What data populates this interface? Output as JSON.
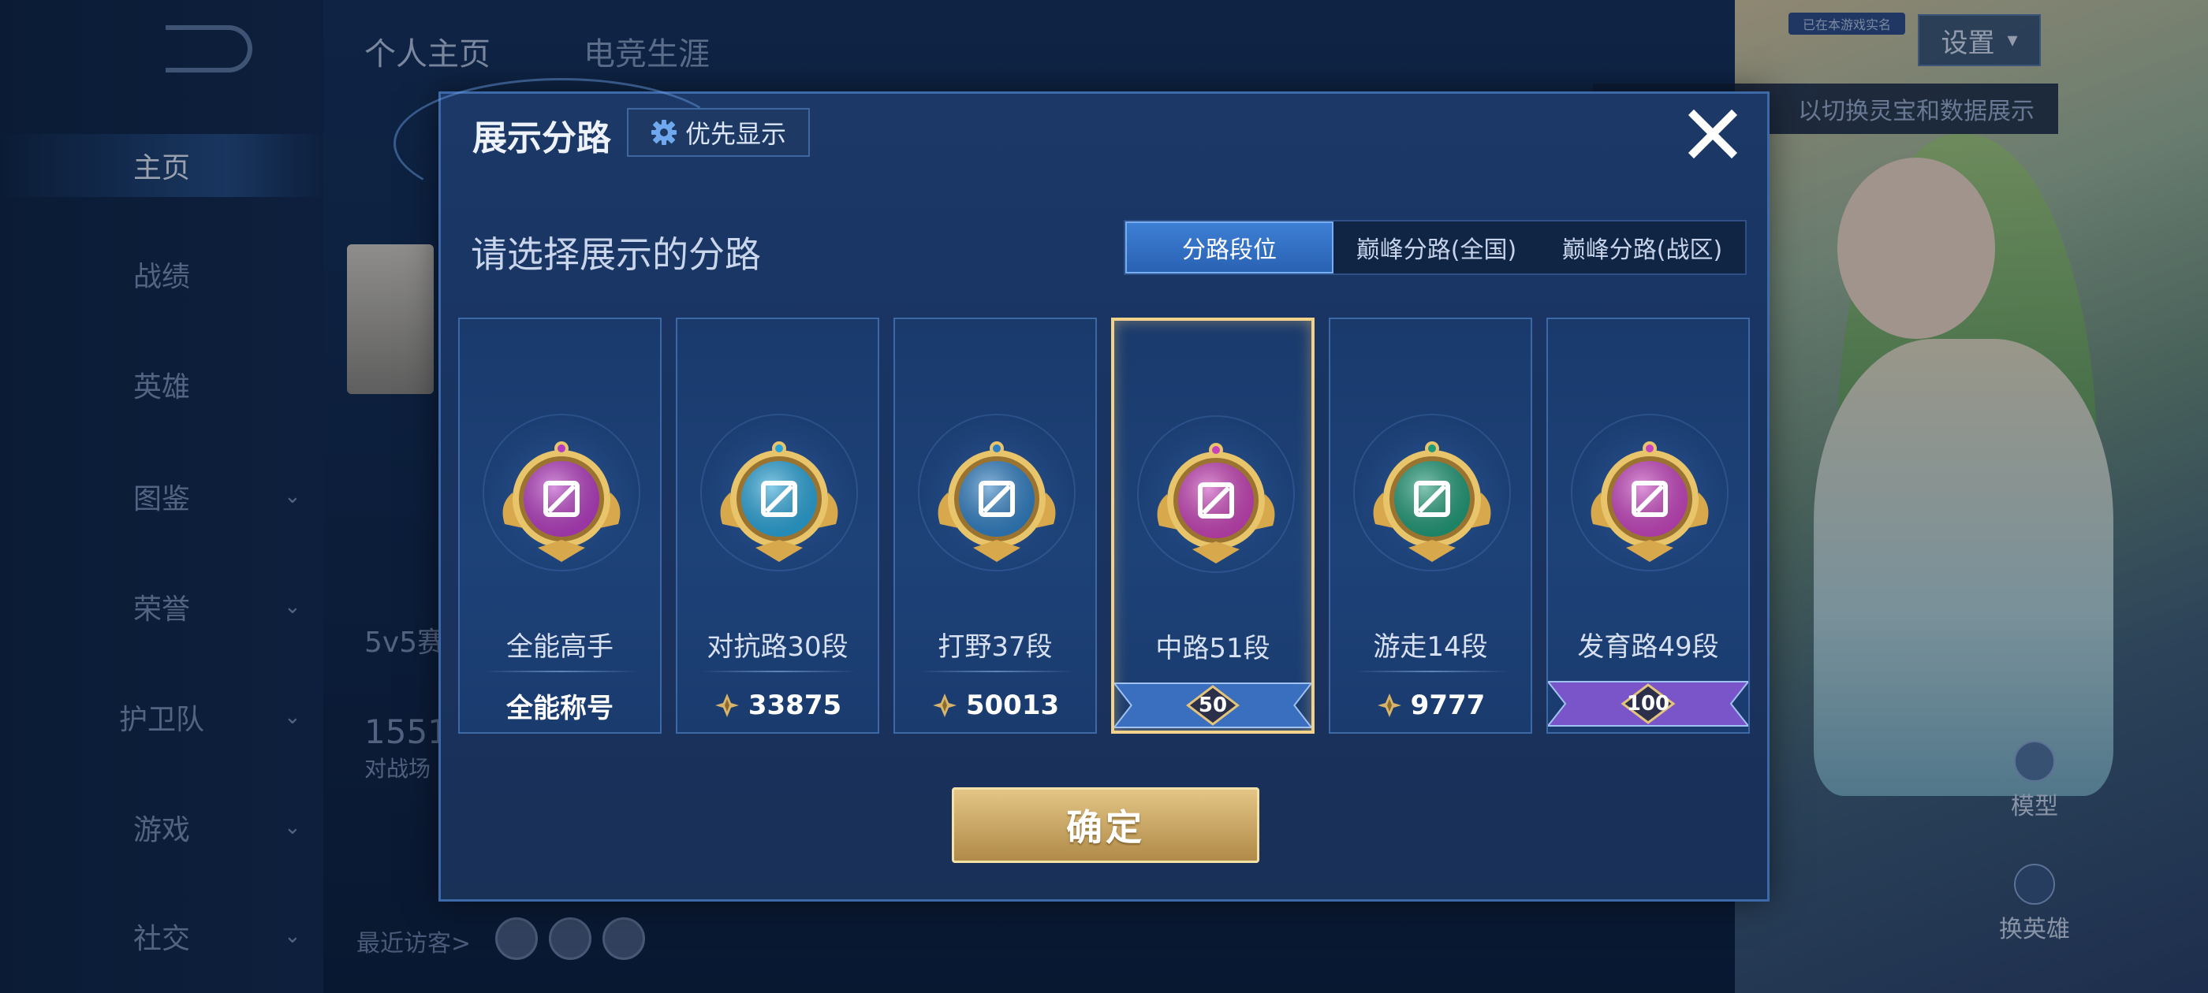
{
  "background": {
    "back_label": "",
    "top_tabs": [
      {
        "label": "个人主页"
      },
      {
        "label": "电竞生涯"
      }
    ],
    "settings_label": "设置",
    "badge_text": "已在本游戏实名",
    "tip_text": "以切换灵宝和数据展示",
    "sidebar": [
      {
        "label": "主页",
        "active": true
      },
      {
        "label": "战绩"
      },
      {
        "label": "英雄"
      },
      {
        "label": "图鉴",
        "has_chevron": true
      },
      {
        "label": "荣誉",
        "has_chevron": true
      },
      {
        "label": "护卫队",
        "has_chevron": true
      },
      {
        "label": "游戏",
        "has_chevron": true
      },
      {
        "label": "社交",
        "has_chevron": true
      }
    ],
    "left_stat_1": "5v5赛",
    "left_stat_2": "1551",
    "left_stat_3": "对战场",
    "visitors_label": "最近访客>",
    "right_buttons": [
      {
        "label": "模型"
      },
      {
        "label": "换英雄"
      }
    ]
  },
  "modal": {
    "title": "展示分路",
    "priority_label": "优先显示",
    "prompt": "请选择展示的分路",
    "tabs": [
      {
        "label": "分路段位",
        "active": true
      },
      {
        "label": "巅峰分路(全国)"
      },
      {
        "label": "巅峰分路(战区)"
      }
    ],
    "cards": [
      {
        "label": "全能高手",
        "value": "全能称号",
        "type": "text",
        "color": "#b53cc2",
        "icon": "allround-icon"
      },
      {
        "label": "对抗路30段",
        "value": "33875",
        "type": "score",
        "color": "#29a4d9",
        "icon": "clash-lane-icon"
      },
      {
        "label": "打野37段",
        "value": "50013",
        "type": "score",
        "color": "#2f7fc4",
        "icon": "jungle-icon"
      },
      {
        "label": "中路51段",
        "value": "50",
        "type": "ribbon",
        "color": "#c742b8",
        "icon": "mid-lane-icon",
        "selected": true,
        "ribbon_color": "#3a6fbf"
      },
      {
        "label": "游走14段",
        "value": "9777",
        "type": "score",
        "color": "#1f9a77",
        "icon": "roam-icon"
      },
      {
        "label": "发育路49段",
        "value": "100",
        "type": "ribbon",
        "color": "#c744c0",
        "icon": "farm-lane-icon",
        "ribbon_color": "#7a55c9"
      }
    ],
    "confirm_label": "确定"
  }
}
